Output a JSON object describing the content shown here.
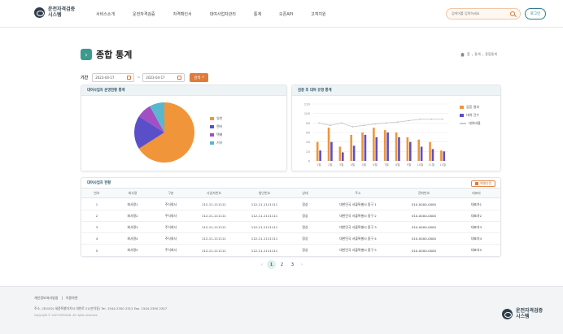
{
  "header": {
    "logo_line1": "운전자격검증",
    "logo_line2": "시스템",
    "nav": [
      "서비스소개",
      "운전자격검증",
      "자격확인서",
      "대여사업자관리",
      "통계",
      "오픈API",
      "고객지원"
    ],
    "search_placeholder": "검색어를 입력하세요",
    "login_label": "로그인"
  },
  "page": {
    "title": "종합 통계",
    "breadcrumb": [
      "홈",
      "통계",
      "종합통계"
    ]
  },
  "filter": {
    "label": "기간",
    "start_date": "2023-04-17",
    "end_date": "2023-04-17",
    "search_label": "검색"
  },
  "pie_panel": {
    "title": "대여사업자 운영현황 통계",
    "legend": [
      {
        "label": "일반",
        "color": "#f0953a"
      },
      {
        "label": "렌터",
        "color": "#5b4fc9"
      },
      {
        "label": "택배",
        "color": "#a34fc4"
      },
      {
        "label": "기타",
        "color": "#58b7cf"
      }
    ]
  },
  "bar_panel": {
    "title": "검증 후 대여 유형 통계",
    "legend": [
      {
        "label": "검증 결과",
        "color": "#f0953a"
      },
      {
        "label": "대여 건수",
        "color": "#5b4fc9"
      },
      {
        "label": "대여비율",
        "color": "#c9ccd1"
      }
    ]
  },
  "chart_data": [
    {
      "type": "pie",
      "categories": [
        "일반",
        "렌터",
        "택배",
        "기타"
      ],
      "values": [
        66,
        18,
        8,
        8
      ]
    },
    {
      "type": "bar",
      "categories": [
        "1월",
        "2월",
        "3월",
        "4월",
        "5월",
        "6월",
        "7월",
        "8월",
        "9월",
        "10월",
        "11월",
        "12월"
      ],
      "series": [
        {
          "name": "검증 결과",
          "type": "bar",
          "values": [
            40,
            70,
            30,
            55,
            60,
            70,
            65,
            60,
            50,
            45,
            40,
            22
          ]
        },
        {
          "name": "대여 건수",
          "type": "bar",
          "values": [
            22,
            40,
            18,
            32,
            55,
            50,
            60,
            50,
            40,
            30,
            25,
            20
          ]
        },
        {
          "name": "대여비율",
          "type": "line",
          "values": [
            80,
            75,
            80,
            72,
            75,
            78,
            80,
            82,
            85,
            88,
            88,
            88
          ]
        }
      ],
      "ylim": [
        0,
        120
      ],
      "yticks": [
        "0",
        "20",
        "40",
        "60",
        "80",
        "100",
        "120"
      ]
    }
  ],
  "table": {
    "title": "대여사업자 현황",
    "excel_label": "엑셀다운",
    "headers": [
      "번호",
      "회사명",
      "구분",
      "사업자번호",
      "법인번호",
      "상태",
      "주소",
      "전화번호",
      "대표자"
    ],
    "rows": [
      [
        "1",
        "회사명1",
        "주식회사",
        "112-11-111111",
        "112-11-1111111",
        "정상",
        "대한민국 서울특별시 중구 1",
        "010-0000-0000",
        "대표자1"
      ],
      [
        "2",
        "회사명2",
        "주식회사",
        "112-11-111111",
        "112-11-1111111",
        "정상",
        "대한민국 서울특별시 중구 2",
        "010-0000-0000",
        "대표자2"
      ],
      [
        "3",
        "회사명3",
        "주식회사",
        "112-11-111111",
        "112-11-1111111",
        "정상",
        "대한민국 서울특별시 중구 3",
        "010-0000-0000",
        "대표자3"
      ],
      [
        "4",
        "회사명4",
        "주식회사",
        "112-11-111111",
        "112-11-1111111",
        "정상",
        "대한민국 서울특별시 중구 4",
        "010-0000-0000",
        "대표자4"
      ],
      [
        "5",
        "회사명5",
        "주식회사",
        "112-11-111111",
        "112-11-1111111",
        "정상",
        "대한민국 서울특별시 중구 5",
        "010-0000-0000",
        "대표자5"
      ]
    ]
  },
  "pagination": {
    "prev": "‹",
    "pages": [
      "1",
      "2",
      "3"
    ],
    "current": "1",
    "next": "›"
  },
  "footer": {
    "links": [
      "개인정보처리방침",
      "|",
      "이용약관"
    ],
    "address": "주소. (30102) 세종특별자치시 대한로 21(만석동)    Tel. 1544-2300 2312    Fax. 1544-2300 2347",
    "copyright": "Copyright © 2023 KOROAD. All rights reserved.",
    "logo_line1": "운전자격검증",
    "logo_line2": "시스템"
  }
}
